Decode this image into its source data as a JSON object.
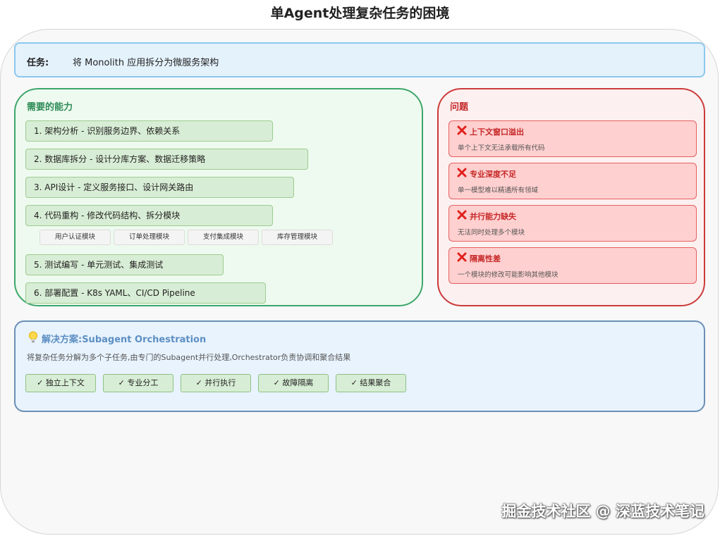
{
  "title": "单Agent处理复杂任务的困境",
  "task": {
    "label": "任务:",
    "text": "将 Monolith 应用拆分为微服务架构"
  },
  "abilities": {
    "title": "需要的能力",
    "items": [
      "1. 架构分析 - 识别服务边界、依赖关系",
      "2. 数据库拆分 - 设计分库方案、数据迁移策略",
      "3. API设计 - 定义服务接口、设计网关路由",
      "4. 代码重构 - 修改代码结构、拆分模块",
      "5. 测试编写 - 单元测试、集成测试",
      "6. 部署配置 - K8s YAML、CI/CD Pipeline"
    ],
    "modules": [
      "用户认证模块",
      "订单处理模块",
      "支付集成模块",
      "库存管理模块"
    ]
  },
  "problems": {
    "title": "问题",
    "items": [
      {
        "title": "上下文窗口溢出",
        "desc": "单个上下文无法承载所有代码",
        "icon": "cross-mark-icon"
      },
      {
        "title": "专业深度不足",
        "desc": "单一模型难以精通所有领域",
        "icon": "cross-mark-icon"
      },
      {
        "title": "并行能力缺失",
        "desc": "无法同时处理多个模块",
        "icon": "cross-mark-icon"
      },
      {
        "title": "隔离性差",
        "desc": "一个模块的修改可能影响其他模块",
        "icon": "cross-mark-icon"
      }
    ]
  },
  "solution": {
    "icon": "lightbulb-icon",
    "title": "解决方案:Subagent Orchestration",
    "desc": "将复杂任务分解为多个子任务,由专门的Subagent并行处理,Orchestrator负责协调和聚合结果",
    "features": [
      "✓ 独立上下文",
      "✓ 专业分工",
      "✓ 并行执行",
      "✓ 故障隔离",
      "✓ 结果聚合"
    ]
  },
  "watermark": "掘金技术社区 @ 深蓝技术笔记",
  "colors": {
    "ability_border": "#3da66a",
    "problem_border": "#cc3a3a",
    "solution_border": "#6b8fb5",
    "task_border": "#8cc8ec"
  }
}
